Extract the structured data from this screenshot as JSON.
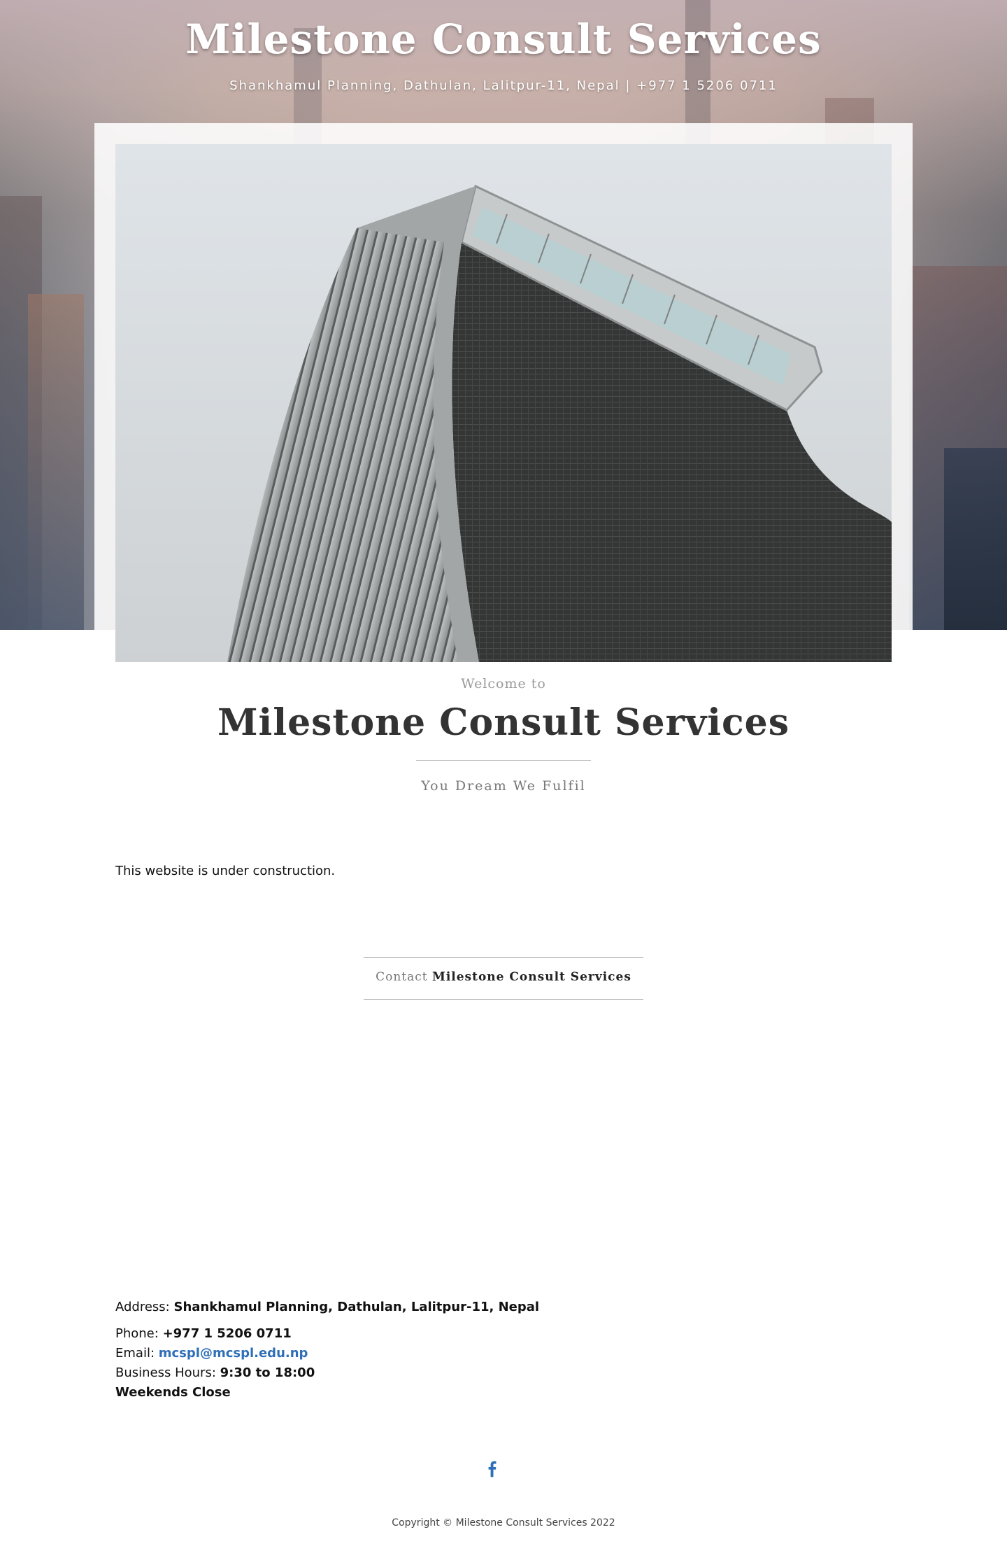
{
  "header": {
    "title": "Milestone Consult Services",
    "subtitle": "Shankhamul Planning, Dathulan, Lalitpur-11, Nepal | +977 1 5206 0711"
  },
  "feature": {
    "image_alt": "Modern curved glass skyscraper"
  },
  "welcome": {
    "intro": "Welcome to",
    "title": "Milestone Consult Services",
    "tagline": "You Dream We Fulfil"
  },
  "body": {
    "notice": "This website is under construction."
  },
  "contact": {
    "heading_prefix": "Contact",
    "heading_name": "Milestone Consult Services",
    "address_label": "Address:",
    "address_value": "Shankhamul Planning, Dathulan, Lalitpur-11, Nepal",
    "phone_label": "Phone:",
    "phone_value": "+977 1 5206 0711",
    "email_label": "Email:",
    "email_value": "mcspl@mcspl.edu.np",
    "hours_label": "Business Hours:",
    "hours_value": "9:30 to 18:00",
    "weekend_note": "Weekends Close"
  },
  "social": {
    "facebook_icon": "facebook-icon"
  },
  "footer": {
    "copyright": "Copyright © Milestone Consult Services 2022"
  },
  "colors": {
    "link": "#2e6fb7",
    "heading": "#333333",
    "muted": "#9a9a9a"
  }
}
